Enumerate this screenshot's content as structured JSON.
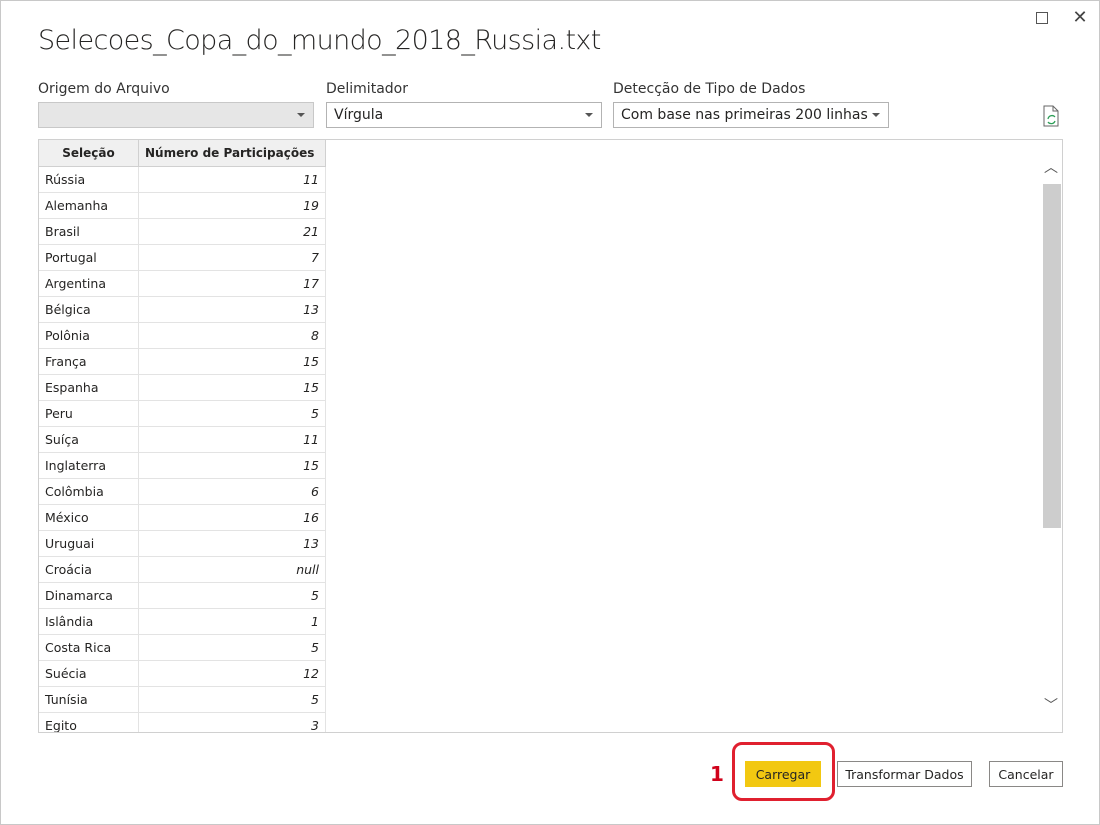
{
  "dialog": {
    "title": "Selecoes_Copa_do_mundo_2018_Russia.txt"
  },
  "options": {
    "file_origin": {
      "label": "Origem do Arquivo",
      "value": ""
    },
    "delimiter": {
      "label": "Delimitador",
      "value": "Vírgula"
    },
    "type_detection": {
      "label": "Detecção de Tipo de Dados",
      "value": "Com base nas primeiras 200 linhas"
    }
  },
  "table": {
    "headers": [
      "Seleção",
      "Número de Participações"
    ],
    "rows": [
      [
        "Rússia",
        "11"
      ],
      [
        "Alemanha",
        "19"
      ],
      [
        "Brasil",
        "21"
      ],
      [
        "Portugal",
        "7"
      ],
      [
        "Argentina",
        "17"
      ],
      [
        "Bélgica",
        "13"
      ],
      [
        "Polônia",
        "8"
      ],
      [
        "França",
        "15"
      ],
      [
        "Espanha",
        "15"
      ],
      [
        "Peru",
        "5"
      ],
      [
        "Suíça",
        "11"
      ],
      [
        "Inglaterra",
        "15"
      ],
      [
        "Colômbia",
        "6"
      ],
      [
        "México",
        "16"
      ],
      [
        "Uruguai",
        "13"
      ],
      [
        "Croácia",
        "null"
      ],
      [
        "Dinamarca",
        "5"
      ],
      [
        "Islândia",
        "1"
      ],
      [
        "Costa Rica",
        "5"
      ],
      [
        "Suécia",
        "12"
      ],
      [
        "Tunísia",
        "5"
      ],
      [
        "Egito",
        "3"
      ]
    ]
  },
  "annotation": {
    "step": "1",
    "color": "#e0202f"
  },
  "buttons": {
    "load": "Carregar",
    "transform": "Transformar Dados",
    "cancel": "Cancelar"
  },
  "colors": {
    "primary_button": "#f2c811"
  },
  "icons": {
    "maximize": "maximize-icon",
    "close": "close-icon",
    "refresh": "refresh-file-icon"
  }
}
